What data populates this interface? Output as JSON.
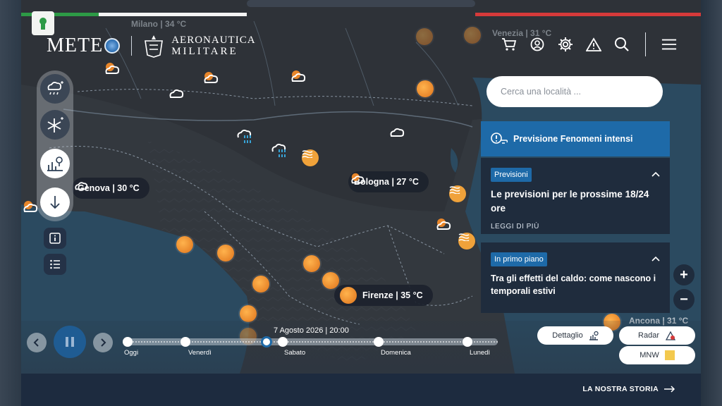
{
  "header": {
    "logo_meteo": "METE",
    "logo_am_line1": "AERONAUTICA",
    "logo_am_line2": "MILITARE",
    "icons": [
      "cart-icon",
      "user-icon",
      "gear-icon",
      "warning-icon",
      "search-icon",
      "menu-icon"
    ]
  },
  "map": {
    "faint_labels": [
      "Milano | 34 °C",
      "Venezia | 31 °C",
      "Ancona | 31 °C"
    ],
    "cities": [
      {
        "name": "Genova | 30 °C"
      },
      {
        "name": "Bologna | 27 °C"
      },
      {
        "name": "Firenze | 35 °C"
      }
    ]
  },
  "search": {
    "placeholder": "Cerca una località ..."
  },
  "panel": {
    "title": "Previsione Fenomeni intensi",
    "cards": [
      {
        "badge": "Previsioni",
        "title": "Le previsioni per le prossime 18/24 ore",
        "more": "LEGGI DI PIÙ"
      },
      {
        "badge": "In primo piano",
        "title": "Tra gli effetti del caldo: come nascono i temporali estivi"
      }
    ]
  },
  "zoom": {
    "in": "+",
    "out": "−"
  },
  "timeline": {
    "current": "7 Agosto 2026 | 20:00",
    "days": [
      "Oggi",
      "Venerdì",
      "Sabato",
      "Domenica",
      "Lunedì"
    ]
  },
  "controls": {
    "detail": "Dettaglio",
    "radar": "Radar",
    "mnw": "MNW"
  },
  "footer": {
    "link": "LA NOSTRA STORIA"
  },
  "colors": {
    "accent": "#1e6aa8",
    "panel": "#1f2c3d",
    "footer": "#1d2b3f",
    "sun": "#e8862a"
  }
}
